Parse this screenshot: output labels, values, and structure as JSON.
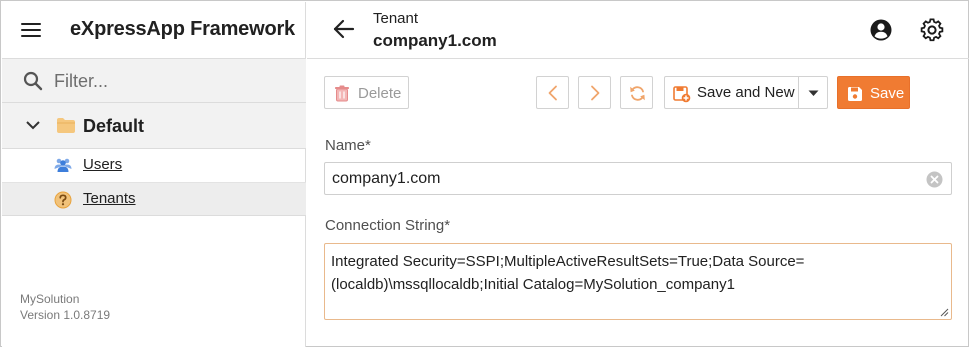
{
  "app": {
    "title": "eXpressApp Framework",
    "filter_placeholder": "Filter...",
    "solution_name": "MySolution",
    "version": "Version 1.0.8719"
  },
  "navigation": {
    "group": {
      "label": "Default",
      "expanded": true
    },
    "items": [
      {
        "label": "Users",
        "icon": "users-icon",
        "selected": false
      },
      {
        "label": "Tenants",
        "icon": "question-icon",
        "selected": true
      }
    ]
  },
  "view": {
    "object_type": "Tenant",
    "object_name": "company1.com"
  },
  "toolbar": {
    "delete_label": "Delete",
    "save_and_new_label": "Save and New",
    "save_label": "Save"
  },
  "form": {
    "name_label": "Name*",
    "name_value": "company1.com",
    "connection_label": "Connection String*",
    "connection_value": "Integrated Security=SSPI;MultipleActiveResultSets=True;Data Source=(localdb)\\mssqllocaldb;Initial Catalog=MySolution_company1"
  },
  "colors": {
    "accent": "#f07b32",
    "users_icon": "#3d7edb",
    "tenants_icon": "#e8a33d",
    "folder": "#f5c77e"
  }
}
